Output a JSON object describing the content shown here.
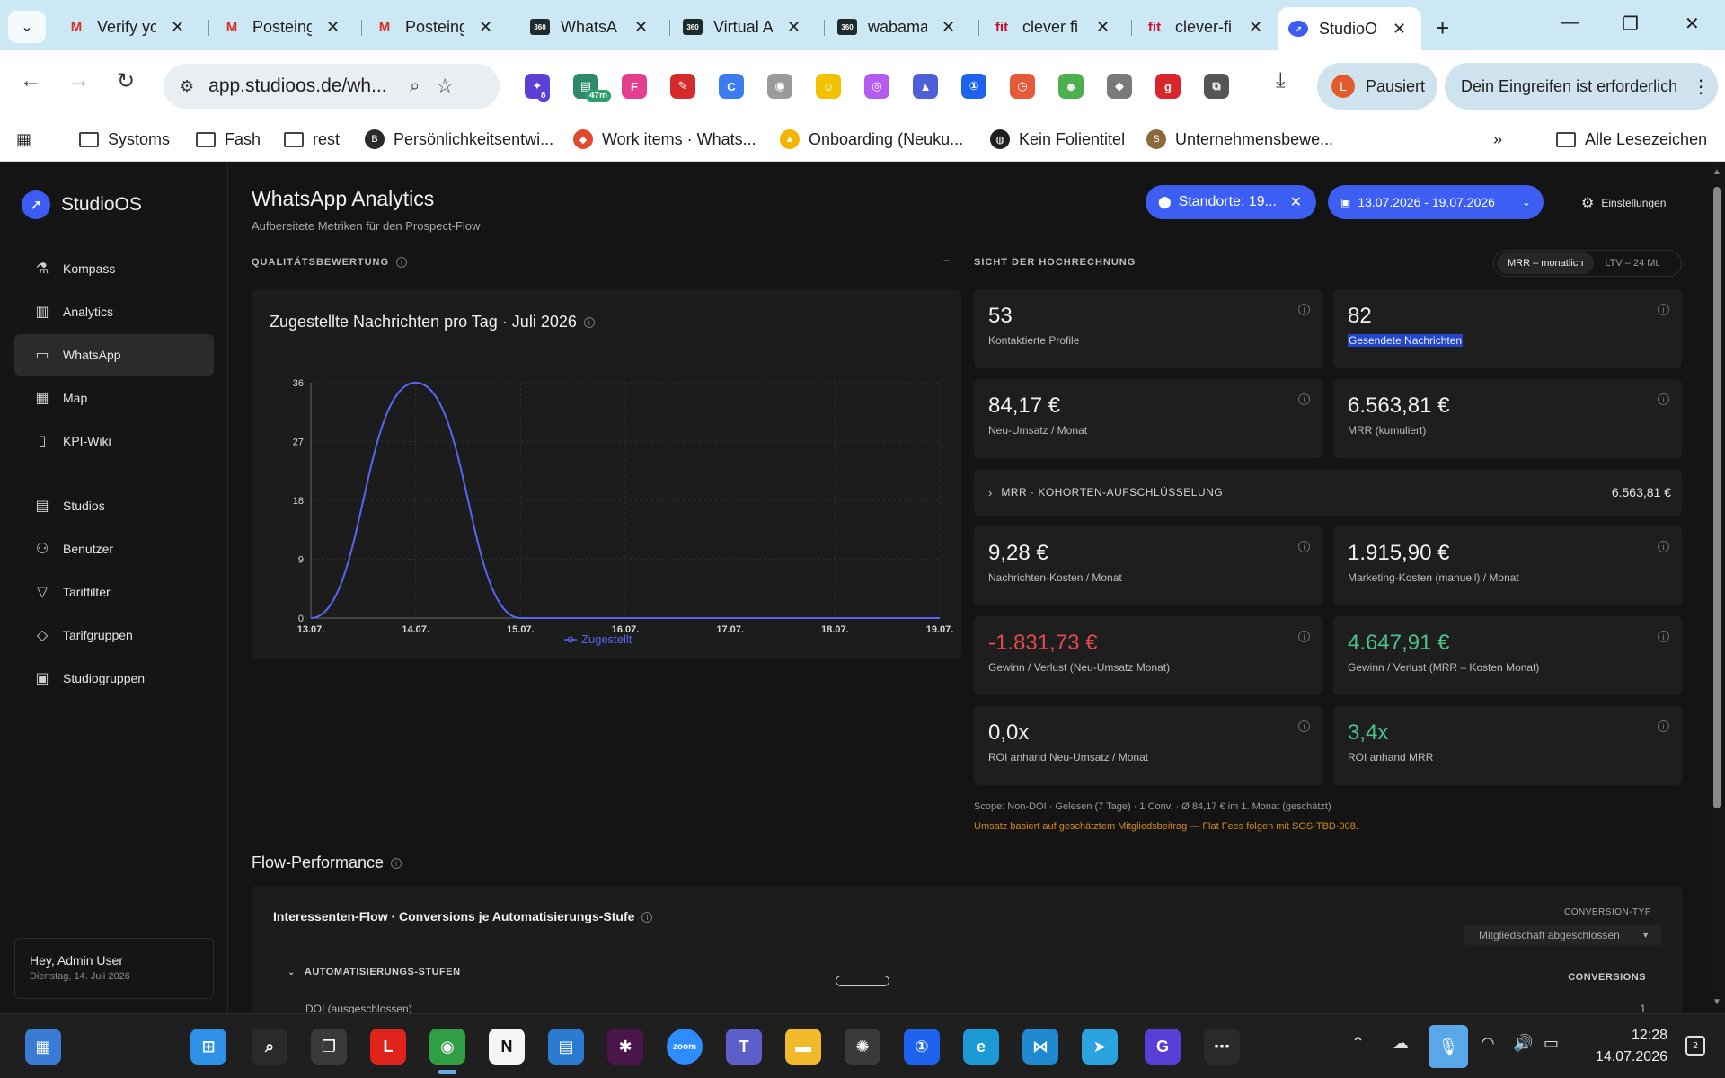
{
  "browser": {
    "tabs": [
      {
        "title": "Verify yo",
        "icon": "gmail-icon",
        "glyph": "M",
        "color": "#d93025"
      },
      {
        "title": "Posteing",
        "icon": "gmail-icon",
        "glyph": "M",
        "color": "#d93025"
      },
      {
        "title": "Posteing",
        "icon": "gmail-icon",
        "glyph": "M",
        "color": "#d93025"
      },
      {
        "title": "WhatsA",
        "icon": "360dialog-icon",
        "glyph": "360",
        "color": "#1e2b2b"
      },
      {
        "title": "Virtual A",
        "icon": "360dialog-icon",
        "glyph": "360",
        "color": "#1e2b2b"
      },
      {
        "title": "wabama",
        "icon": "360dialog-icon",
        "glyph": "360",
        "color": "#1e2b2b"
      },
      {
        "title": "clever fi",
        "icon": "clever-fit-icon",
        "glyph": "fit",
        "color": "#c8102e"
      },
      {
        "title": "clever-fi",
        "icon": "clever-fit-icon",
        "glyph": "fit",
        "color": "#c8102e"
      },
      {
        "title": "StudioO",
        "icon": "studioos-icon",
        "glyph": "➚",
        "color": "#3d5cf5",
        "active": true
      }
    ],
    "url": "app.studioos.de/wh...",
    "profile": {
      "initial": "L",
      "label": "Pausiert"
    },
    "action_required": "Dein Eingreifen ist erforderlich",
    "extensions": [
      {
        "name": "extension-badge-icon",
        "glyph": "✦",
        "color": "#5b3fd6",
        "badge": "8",
        "badge_color": "#5b3fd6"
      },
      {
        "name": "timer-extension-icon",
        "glyph": "▤",
        "color": "#2f8a6b",
        "badge": "47m",
        "badge_color": "#2f9d6e"
      },
      {
        "name": "figma-icon",
        "glyph": "F",
        "color": "#e43f8f"
      },
      {
        "name": "dropper-icon",
        "glyph": "✎",
        "color": "#d62b2b"
      },
      {
        "name": "c-circle-icon",
        "glyph": "C",
        "color": "#3b7cf0"
      },
      {
        "name": "camera-icon",
        "glyph": "◉",
        "color": "#9a9a9a"
      },
      {
        "name": "lego-icon",
        "glyph": "☺",
        "color": "#f2c200"
      },
      {
        "name": "ring-icon",
        "glyph": "◎",
        "color": "#b45cf0"
      },
      {
        "name": "cap-icon",
        "glyph": "▲",
        "color": "#4f5fd8"
      },
      {
        "name": "onepassword-icon",
        "glyph": "①",
        "color": "#1d63ed"
      },
      {
        "name": "clock-icon",
        "glyph": "◷",
        "color": "#e45a3a"
      },
      {
        "name": "frog-icon",
        "glyph": "☻",
        "color": "#4caf50"
      },
      {
        "name": "bird-icon",
        "glyph": "◆",
        "color": "#7a7a7a"
      },
      {
        "name": "grammarly-icon",
        "glyph": "g",
        "color": "#d9262c"
      },
      {
        "name": "puzzle-icon",
        "glyph": "⧉",
        "color": "#555555"
      }
    ],
    "bookmarks": [
      {
        "label": "Systoms",
        "icon": "folder-icon"
      },
      {
        "label": "Fash",
        "icon": "folder-icon"
      },
      {
        "label": "rest",
        "icon": "folder-icon"
      },
      {
        "label": "Persönlichkeitsentwi...",
        "icon": "b-badge-icon"
      },
      {
        "label": "Work items · Whats...",
        "icon": "gitlab-icon"
      },
      {
        "label": "Onboarding (Neuku...",
        "icon": "google-drive-icon"
      },
      {
        "label": "Kein Folientitel",
        "icon": "globe-icon"
      },
      {
        "label": "Unternehmensbewe...",
        "icon": "s-badge-icon"
      }
    ],
    "all_bookmarks": "Alle Lesezeichen"
  },
  "app": {
    "brand": "StudioOS",
    "nav": [
      {
        "label": "Kompass",
        "icon": "flask-icon",
        "glyph": "⚗"
      },
      {
        "label": "Analytics",
        "icon": "bar-chart-icon",
        "glyph": "▥"
      },
      {
        "label": "WhatsApp",
        "icon": "chat-icon",
        "glyph": "▭",
        "active": true
      },
      {
        "label": "Map",
        "icon": "map-icon",
        "glyph": "▦"
      },
      {
        "label": "KPI-Wiki",
        "icon": "book-icon",
        "glyph": "▯"
      },
      {
        "label": "Studios",
        "icon": "building-icon",
        "glyph": "▤"
      },
      {
        "label": "Benutzer",
        "icon": "users-icon",
        "glyph": "⚇"
      },
      {
        "label": "Tariffilter",
        "icon": "filter-icon",
        "glyph": "▽"
      },
      {
        "label": "Tarifgruppen",
        "icon": "tag-icon",
        "glyph": "◇"
      },
      {
        "label": "Studiogruppen",
        "icon": "group-icon",
        "glyph": "▣"
      }
    ],
    "user": {
      "greeting": "Hey, Admin User",
      "date": "Dienstag, 14. Juli 2026"
    }
  },
  "page": {
    "title": "WhatsApp Analytics",
    "subtitle": "Aufbereitete Metriken für den Prospect-Flow",
    "locations_filter": "Standorte: 19...",
    "date_range": "13.07.2026 - 19.07.2026",
    "settings": "Einstellungen",
    "quality_label": "QUALITÄTSBEWERTUNG",
    "quality_dash": "–",
    "projection_label": "SICHT DER HOCHRECHNUNG",
    "toggle": {
      "mrr": "MRR – monatlich",
      "ltv": "LTV – 24 Mt."
    },
    "chart_title": "Zugestellte Nachrichten pro Tag · Juli 2026",
    "kpis": [
      {
        "value": "53",
        "label": "Kontaktierte Profile",
        "tone": "normal"
      },
      {
        "value": "82",
        "label": "Gesendete Nachrichten",
        "tone": "normal",
        "selected": true
      },
      {
        "value": "84,17 €",
        "label": "Neu-Umsatz / Monat",
        "tone": "normal"
      },
      {
        "value": "6.563,81 €",
        "label": "MRR (kumuliert)",
        "tone": "normal"
      },
      {
        "value": "9,28 €",
        "label": "Nachrichten-Kosten / Monat",
        "tone": "normal"
      },
      {
        "value": "1.915,90 €",
        "label": "Marketing-Kosten (manuell) / Monat",
        "tone": "normal"
      },
      {
        "value": "-1.831,73 €",
        "label": "Gewinn / Verlust (Neu-Umsatz Monat)",
        "tone": "negative"
      },
      {
        "value": "4.647,91 €",
        "label": "Gewinn / Verlust (MRR – Kosten Monat)",
        "tone": "positive"
      },
      {
        "value": "0,0x",
        "label": "ROI anhand Neu-Umsatz / Monat",
        "tone": "normal"
      },
      {
        "value": "3,4x",
        "label": "ROI anhand MRR",
        "tone": "positive"
      }
    ],
    "cohort": {
      "label": "MRR · KOHORTEN-AUFSCHLÜSSELUNG",
      "value": "6.563,81 €"
    },
    "scope_note": "Scope: Non-DOI · Gelesen (7 Tage) · 1 Conv. · Ø 84,17 € im 1. Monat (geschätzt)",
    "warn_note": "Umsatz basiert auf geschätztem Mitgliedsbeitrag — Flat Fees folgen mit SOS-TBD-008.",
    "flow_title": "Flow-Performance",
    "flow_card_title": "Interessenten-Flow · Conversions je Automatisierungs-Stufe",
    "conversion_type_label": "CONVERSION-TYP",
    "conversion_type_value": "Mitgliedschaft abgeschlossen",
    "stages_label": "AUTOMATISIERUNGS-STUFEN",
    "conversions_header": "CONVERSIONS",
    "doi_row": "DOI (ausgeschlossen)",
    "doi_value": "1"
  },
  "chart_data": {
    "type": "line",
    "title": "Zugestellte Nachrichten pro Tag · Juli 2026",
    "categories": [
      "13.07.",
      "14.07.",
      "15.07.",
      "16.07.",
      "17.07.",
      "18.07.",
      "19.07."
    ],
    "series": [
      {
        "name": "Zugestellt",
        "values": [
          0,
          36,
          0,
          0,
          0,
          0,
          0
        ],
        "color": "#5865f2"
      }
    ],
    "yticks": [
      0,
      9,
      18,
      27,
      36
    ],
    "ylim": [
      0,
      36
    ],
    "grid": true,
    "legend": "bottom",
    "xlabel": "",
    "ylabel": ""
  },
  "taskbar": {
    "apps": [
      {
        "name": "widgets-icon",
        "glyph": "▦",
        "color": "#3a7bd5"
      },
      {
        "name": "windows-start-icon",
        "glyph": "⊞",
        "color": "#2f90e8"
      },
      {
        "name": "search-icon",
        "glyph": "⌕",
        "color": "#2a2a2a"
      },
      {
        "name": "task-view-icon",
        "glyph": "❐",
        "color": "#3a3a3a"
      },
      {
        "name": "l-app-icon",
        "glyph": "L",
        "color": "#e0241b"
      },
      {
        "name": "chrome-icon",
        "glyph": "◉",
        "color": "#2f9e44"
      },
      {
        "name": "notion-icon",
        "glyph": "N",
        "color": "#f5f5f5"
      },
      {
        "name": "book-app-icon",
        "glyph": "▤",
        "color": "#2b7bd1"
      },
      {
        "name": "slack-icon",
        "glyph": "✱",
        "color": "#4a154b"
      },
      {
        "name": "zoom-icon",
        "glyph": "zoom",
        "color": "#2d8cff"
      },
      {
        "name": "teams-icon",
        "glyph": "T",
        "color": "#5b5fc7"
      },
      {
        "name": "file-explorer-icon",
        "glyph": "▬",
        "color": "#f2b92a"
      },
      {
        "name": "chatgpt-icon",
        "glyph": "✺",
        "color": "#3a3a3a"
      },
      {
        "name": "onepassword-app-icon",
        "glyph": "①",
        "color": "#1d63ed"
      },
      {
        "name": "edge-icon",
        "glyph": "e",
        "color": "#1c9ad6"
      },
      {
        "name": "vscode-icon",
        "glyph": "⋈",
        "color": "#1f8ad2"
      },
      {
        "name": "telegram-icon",
        "glyph": "➤",
        "color": "#2aa3df"
      },
      {
        "name": "g-app-icon",
        "glyph": "G",
        "color": "#5a3fd6"
      },
      {
        "name": "more-icon",
        "glyph": "⋯",
        "color": "#2a2a2a"
      }
    ],
    "time": "12:28",
    "date": "14.07.2026"
  }
}
